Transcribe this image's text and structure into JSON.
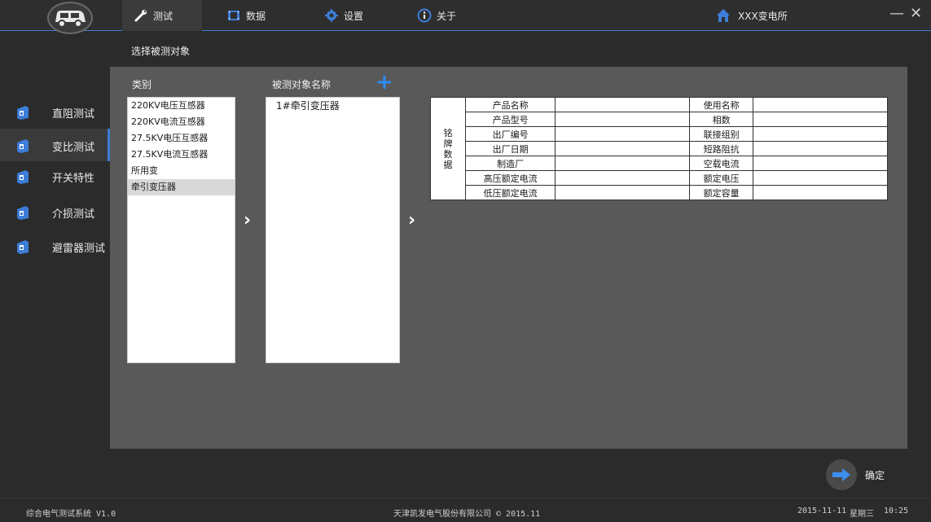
{
  "topbar": {
    "tabs": [
      {
        "label": "测试",
        "icon": "wrench-icon"
      },
      {
        "label": "数据",
        "icon": "film-icon"
      },
      {
        "label": "设置",
        "icon": "gear-icon"
      },
      {
        "label": "关于",
        "icon": "info-icon"
      }
    ],
    "location": "XXX变电所",
    "minimize": "—",
    "close": "✕",
    "accent": "#3d7dd8"
  },
  "subheader": {
    "title": "选择被测对象"
  },
  "sidebar": {
    "items": [
      {
        "label": "直阻测试"
      },
      {
        "label": "变比测试"
      },
      {
        "label": "开关特性"
      },
      {
        "label": "介损测试"
      },
      {
        "label": "避雷器测试"
      }
    ]
  },
  "main": {
    "category_label": "类别",
    "categories": [
      "220KV电压互感器",
      "220KV电流互感器",
      "27.5KV电压互感器",
      "27.5KV电流互感器",
      "所用变",
      "牵引变压器"
    ],
    "object_label": "被测对象名称",
    "objects": [
      "1#牵引变压器"
    ],
    "add": "+",
    "arrow": "›",
    "nameplate": {
      "group_label": [
        "铭",
        "牌",
        "数",
        "据"
      ],
      "left_fields": [
        "产品名称",
        "产品型号",
        "出厂编号",
        "出厂日期",
        "制造厂",
        "高压额定电流",
        "低压额定电流"
      ],
      "right_fields": [
        "使用名称",
        "相数",
        "联接组别",
        "短路阻抗",
        "空载电流",
        "额定电压",
        "额定容量"
      ]
    }
  },
  "confirm": {
    "label": "确定"
  },
  "statusbar": {
    "app": "综合电气测试系统 V1.0",
    "company": "天津凯发电气股份有限公司 © 2015.11",
    "date": "2015-11-11",
    "weekday": "星期三",
    "time": "10:25"
  }
}
